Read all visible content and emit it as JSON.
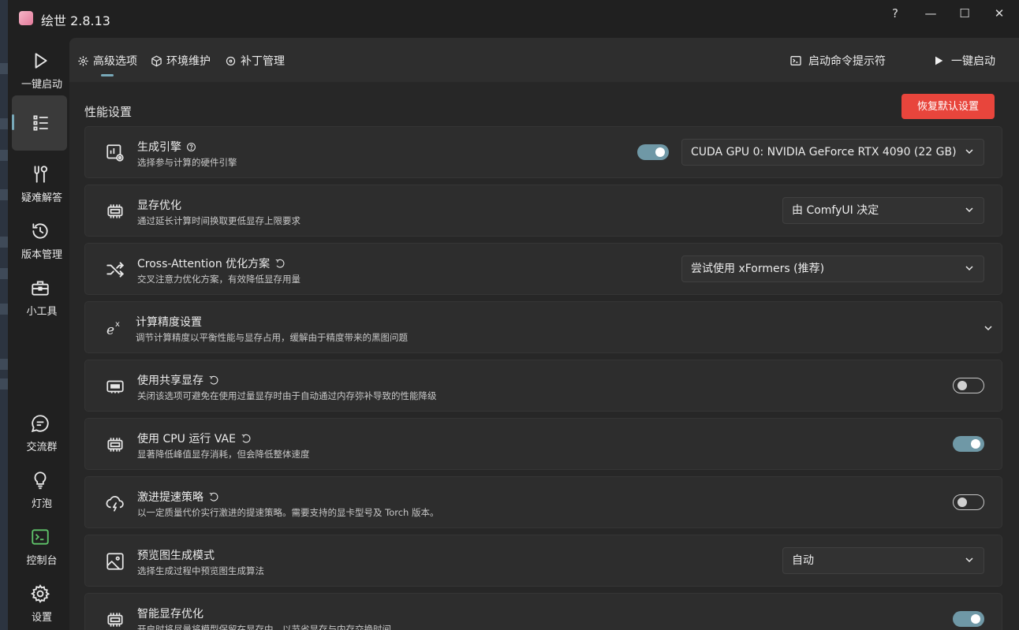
{
  "app": {
    "title": "绘世 2.8.13"
  },
  "window_controls": {
    "help": "?",
    "minimize": "—",
    "maximize": "☐",
    "close": "✕"
  },
  "sidebar": {
    "items": [
      {
        "label": "一键启动",
        "icon": "play-icon"
      },
      {
        "label": "",
        "icon": "list-icon",
        "active": true
      },
      {
        "label": "疑难解答",
        "icon": "tools-icon"
      },
      {
        "label": "版本管理",
        "icon": "history-icon"
      },
      {
        "label": "小工具",
        "icon": "toolbox-icon"
      },
      {
        "label": "交流群",
        "icon": "chat-icon"
      },
      {
        "label": "灯泡",
        "icon": "lightbulb-icon"
      },
      {
        "label": "控制台",
        "icon": "terminal-icon"
      },
      {
        "label": "设置",
        "icon": "gear-icon"
      }
    ]
  },
  "tabs": [
    {
      "label": "高级选项",
      "active": true
    },
    {
      "label": "环境维护"
    },
    {
      "label": "补丁管理"
    }
  ],
  "top_actions": {
    "terminal": "启动命令提示符",
    "launch": "一键启动"
  },
  "section": {
    "title": "性能设置",
    "reset_label": "恢复默认设置"
  },
  "settings": [
    {
      "title": "生成引擎",
      "desc": "选择参与计算的硬件引擎",
      "icon": "engine-icon",
      "help": true,
      "toggle": "on",
      "select": "CUDA GPU 0: NVIDIA GeForce RTX 4090 (22 GB)"
    },
    {
      "title": "显存优化",
      "desc": "通过延长计算时间换取更低显存上限要求",
      "icon": "memory-chip-icon",
      "select": "由 ComfyUI 决定"
    },
    {
      "title": "Cross-Attention 优化方案",
      "desc": "交叉注意力优化方案，有效降低显存用量",
      "icon": "shuffle-icon",
      "restart": true,
      "select": "尝试使用 xFormers (推荐)"
    },
    {
      "title": "计算精度设置",
      "desc": "调节计算精度以平衡性能与显存占用，缓解由于精度带来的黑图问题",
      "icon": "exponent-icon",
      "expandable": true
    },
    {
      "title": "使用共享显存",
      "desc": "关闭该选项可避免在使用过量显存时由于自动通过内存弥补导致的性能降级",
      "icon": "shared-memory-icon",
      "restart": true,
      "toggle": "off"
    },
    {
      "title": "使用 CPU 运行 VAE",
      "desc": "显著降低峰值显存消耗，但会降低整体速度",
      "icon": "cpu-icon",
      "restart": true,
      "toggle": "on"
    },
    {
      "title": "激进提速策略",
      "desc": "以一定质量代价实行激进的提速策略。需要支持的显卡型号及 Torch 版本。",
      "icon": "cloud-bolt-icon",
      "restart": true,
      "toggle": "off"
    },
    {
      "title": "预览图生成模式",
      "desc": "选择生成过程中预览图生成算法",
      "icon": "image-icon",
      "select": "自动"
    },
    {
      "title": "智能显存优化",
      "desc": "开启时将尽量将模型保留在显存中，以节省显存与内存交换时间",
      "icon": "memory-chip-icon",
      "toggle": "on"
    }
  ],
  "colors": {
    "accent": "#78a8b8",
    "toggle_on": "#6f98a6",
    "danger": "#e8453c",
    "bg": "#202020",
    "panel": "#272727",
    "card": "#2d2d2d"
  }
}
